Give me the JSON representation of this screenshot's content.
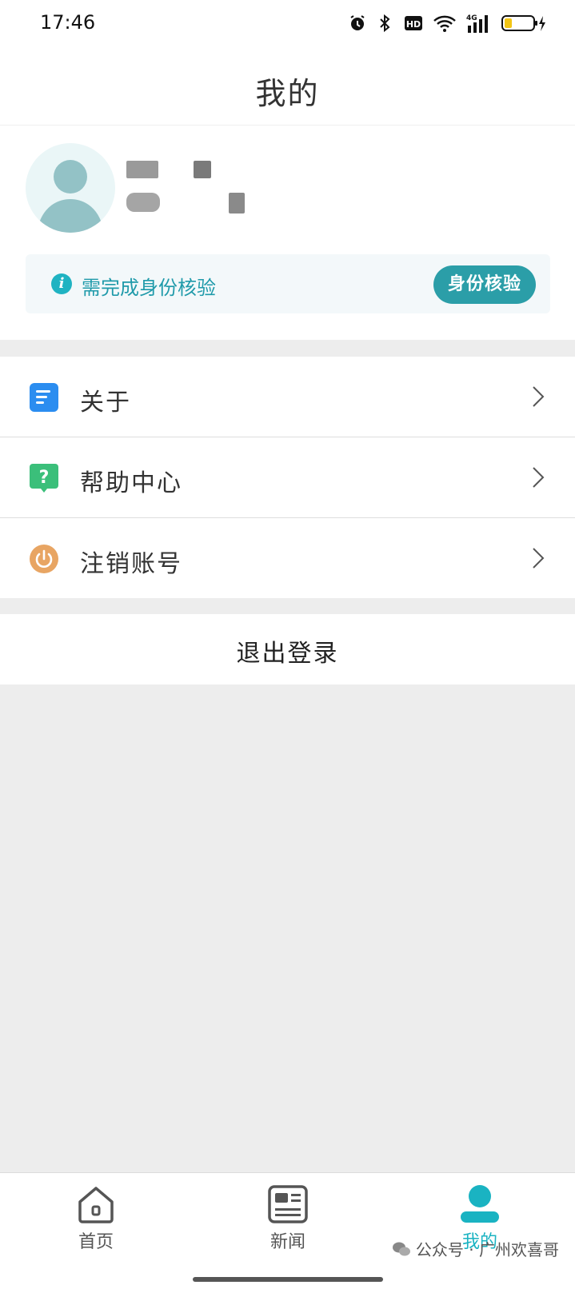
{
  "status_bar": {
    "time": "17:46",
    "network_label": "4G",
    "hd_label": "HD"
  },
  "header": {
    "title": "我的"
  },
  "profile": {
    "verify_notice": "需完成身份核验",
    "verify_button": "身份核验"
  },
  "menu": {
    "items": [
      {
        "label": "关于",
        "icon": "document-icon",
        "color": "#2b8df0"
      },
      {
        "label": "帮助中心",
        "icon": "help-icon",
        "color": "#3bbf7a"
      },
      {
        "label": "注销账号",
        "icon": "power-icon",
        "color": "#e8a563"
      }
    ]
  },
  "logout": {
    "label": "退出登录"
  },
  "tab_bar": {
    "tabs": [
      {
        "label": "首页",
        "icon": "home-icon",
        "active": false
      },
      {
        "label": "新闻",
        "icon": "news-icon",
        "active": false
      },
      {
        "label": "我的",
        "icon": "person-icon",
        "active": true
      }
    ],
    "watermark": "公众号 · 广州欢喜哥"
  },
  "colors": {
    "accent": "#1ab3c2",
    "verify_button": "#2b9ea8",
    "background": "#ededed"
  }
}
